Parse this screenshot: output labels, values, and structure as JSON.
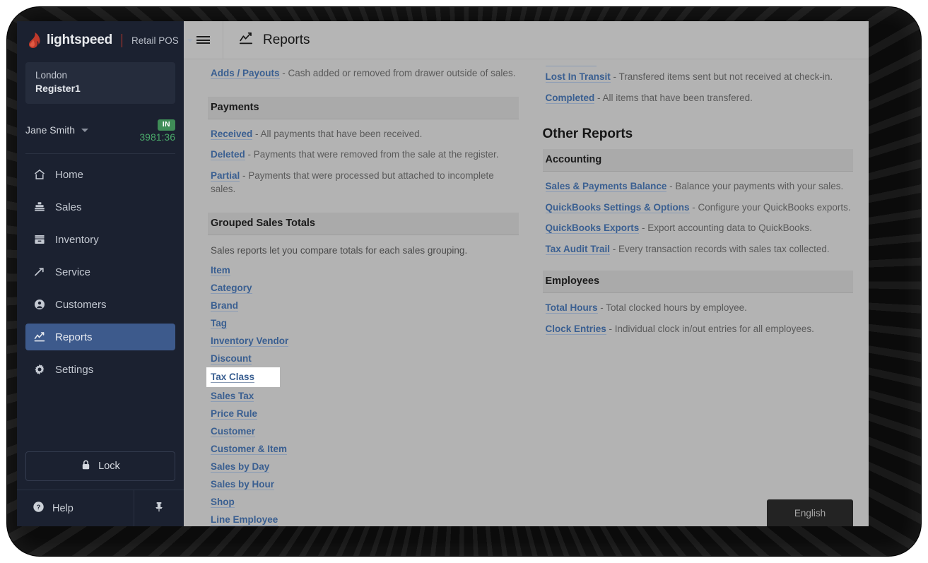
{
  "brand": {
    "logo_icon": "lightspeed-flame-icon",
    "name": "lightspeed",
    "product": "Retail POS",
    "product_caret_icon": "chevron-down-icon"
  },
  "sidebar": {
    "register": {
      "shop": "London",
      "name": "Register1"
    },
    "user": {
      "name": "Jane Smith",
      "caret_icon": "chevron-down-icon",
      "status_badge": "IN",
      "clock_time": "3981:36",
      "badge_color": "#3f8d57",
      "clock_color": "#4aa86a"
    },
    "items": [
      {
        "label": "Home",
        "icon": "home-icon",
        "active": false
      },
      {
        "label": "Sales",
        "icon": "sales-icon",
        "active": false
      },
      {
        "label": "Inventory",
        "icon": "inventory-icon",
        "active": false
      },
      {
        "label": "Service",
        "icon": "service-icon",
        "active": false
      },
      {
        "label": "Customers",
        "icon": "customers-icon",
        "active": false
      },
      {
        "label": "Reports",
        "icon": "reports-icon",
        "active": true
      },
      {
        "label": "Settings",
        "icon": "settings-icon",
        "active": false
      }
    ],
    "lock_label": "Lock",
    "lock_icon": "lock-icon",
    "help_label": "Help",
    "help_icon": "help-circle-icon",
    "pin_icon": "pin-icon",
    "active_color": "#3d5a8c",
    "background_color": "#1b2130"
  },
  "topbar": {
    "menu_icon": "hamburger-menu-icon",
    "title_icon": "chart-line-icon",
    "title": "Reports"
  },
  "left_column": {
    "top_entry": {
      "link": "Adds / Payouts",
      "desc": " - Cash added or removed from drawer outside of sales."
    },
    "payments": {
      "heading": "Payments",
      "entries": [
        {
          "link": "Received",
          "desc": " - All payments that have been received."
        },
        {
          "link": "Deleted",
          "desc": " - Payments that were removed from the sale at the register."
        },
        {
          "link": "Partial",
          "desc": " - Payments that were processed but attached to incomplete sales."
        }
      ]
    },
    "grouped": {
      "heading": "Grouped Sales Totals",
      "intro": "Sales reports let you compare totals for each sales grouping.",
      "links": [
        {
          "label": "Item",
          "highlighted": false
        },
        {
          "label": "Category",
          "highlighted": false
        },
        {
          "label": "Brand",
          "highlighted": false
        },
        {
          "label": "Tag",
          "highlighted": false
        },
        {
          "label": "Inventory Vendor",
          "highlighted": false
        },
        {
          "label": "Discount",
          "highlighted": false
        },
        {
          "label": "Tax Class",
          "highlighted": true
        },
        {
          "label": "Sales Tax",
          "highlighted": false
        },
        {
          "label": "Price Rule",
          "highlighted": false
        },
        {
          "label": "Customer",
          "highlighted": false
        },
        {
          "label": "Customer & Item",
          "highlighted": false
        },
        {
          "label": "Sales by Day",
          "highlighted": false
        },
        {
          "label": "Sales by Hour",
          "highlighted": false
        },
        {
          "label": "Shop",
          "highlighted": false
        },
        {
          "label": "Line Employee",
          "highlighted": false
        }
      ]
    }
  },
  "right_column": {
    "transfers_entries": [
      {
        "link": "Lost In Transit",
        "desc": " - Transfered items sent but not received at check-in."
      },
      {
        "link": "Completed",
        "desc": " - All items that have been transfered."
      }
    ],
    "other_reports_heading": "Other Reports",
    "accounting": {
      "heading": "Accounting",
      "entries": [
        {
          "link": "Sales & Payments Balance",
          "desc": " - Balance your payments with your sales."
        },
        {
          "link": "QuickBooks Settings & Options",
          "desc": " - Configure your QuickBooks exports."
        },
        {
          "link": "QuickBooks Exports",
          "desc": " - Export accounting data to QuickBooks."
        },
        {
          "link": "Tax Audit Trail",
          "desc": " - Every transaction records with sales tax collected."
        }
      ]
    },
    "employees": {
      "heading": "Employees",
      "entries": [
        {
          "link": "Total Hours",
          "desc": " - Total clocked hours by employee."
        },
        {
          "link": "Clock Entries",
          "desc": " - Individual clock in/out entries for all employees."
        }
      ]
    }
  },
  "language_button": {
    "label": "English"
  }
}
